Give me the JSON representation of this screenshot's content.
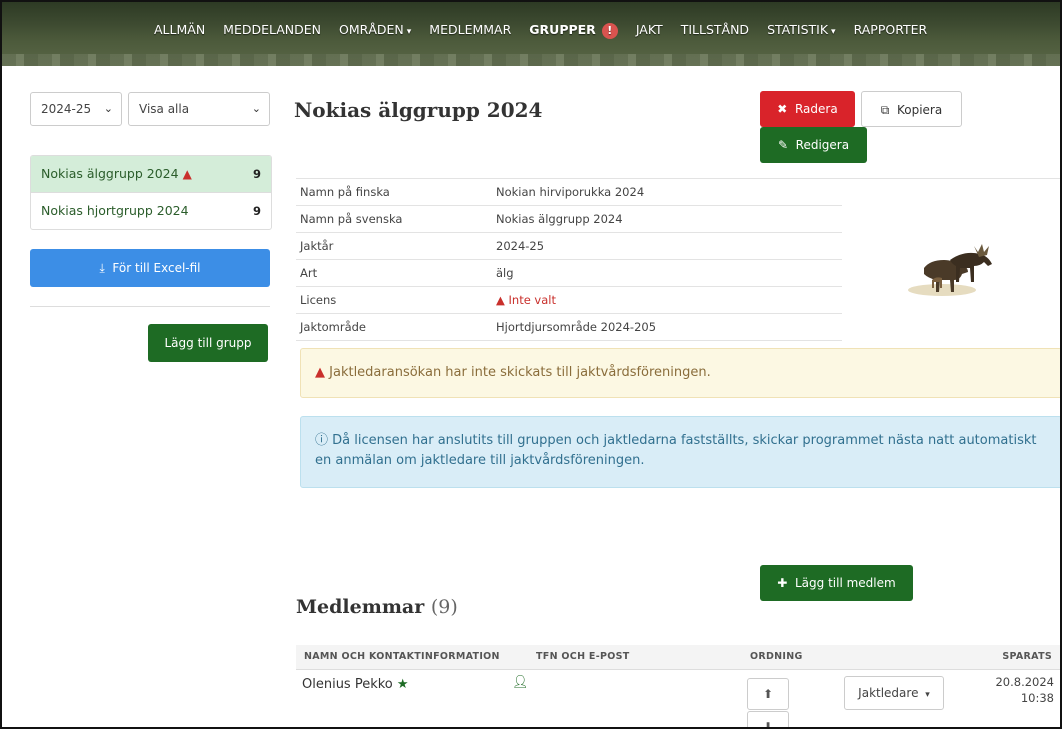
{
  "nav": {
    "items": [
      {
        "label": "ALLMÄN"
      },
      {
        "label": "MEDDELANDEN"
      },
      {
        "label": "OMRÅDEN",
        "dropdown": true
      },
      {
        "label": "MEDLEMMAR"
      },
      {
        "label": "GRUPPER",
        "active": true,
        "alert": "!"
      },
      {
        "label": "JAKT"
      },
      {
        "label": "TILLSTÅND"
      },
      {
        "label": "STATISTIK",
        "dropdown": true
      },
      {
        "label": "RAPPORTER"
      }
    ]
  },
  "sidebar": {
    "year_select": "2024-25",
    "filter_select": "Visa alla",
    "groups": [
      {
        "name": "Nokias älggrupp 2024",
        "count": "9",
        "warning": true,
        "active": true
      },
      {
        "name": "Nokias hjortgrupp 2024",
        "count": "9",
        "warning": false,
        "active": false
      }
    ],
    "excel_button": "För till Excel-fil",
    "add_group_button": "Lägg till grupp"
  },
  "main": {
    "title": "Nokias älggrupp 2024",
    "delete_button": "Radera",
    "copy_button": "Kopiera",
    "edit_button": "Redigera",
    "info": [
      {
        "label": "Namn på finska",
        "value": "Nokian hirviporukka 2024"
      },
      {
        "label": "Namn på svenska",
        "value": "Nokias älggrupp 2024"
      },
      {
        "label": "Jaktår",
        "value": "2024-25"
      },
      {
        "label": "Art",
        "value": "älg"
      },
      {
        "label": "Licens",
        "value": "Inte valt",
        "warning": true
      },
      {
        "label": "Jaktområde",
        "value": "Hjortdjursområde 2024-205"
      }
    ],
    "alert_warning": "Jaktledaransökan har inte skickats till jaktvårdsföreningen.",
    "alert_info": "Då licensen har anslutits till gruppen och jaktledarna fastställts, skickar programmet nästa natt automatiskt en anmälan om jaktledare till jaktvårdsföreningen.",
    "add_member_button": "Lägg till medlem",
    "members_title": "Medlemmar",
    "members_count": "(9)",
    "columns": {
      "name": "NAMN OCH KONTAKTINFORMATION",
      "phone": "TFN OCH E-POST",
      "order": "ORDNING",
      "saved": "SPARATS"
    },
    "members": [
      {
        "name": "Olenius Pekko",
        "leader": true,
        "role": "Jaktledare",
        "saved_date": "20.8.2024",
        "saved_time": "10:38"
      }
    ]
  },
  "colors": {
    "accent_green": "#1e6b24",
    "danger": "#d9232a",
    "excel_blue": "#3c8ee6"
  },
  "icons": [
    "alert-icon",
    "chevron-down-icon",
    "warning-icon",
    "export-icon",
    "times-icon",
    "copy-icon",
    "edit-icon",
    "plus-icon",
    "info-icon",
    "star-icon",
    "person-icon",
    "arrow-up-icon",
    "arrow-down-icon",
    "moose-icon"
  ]
}
